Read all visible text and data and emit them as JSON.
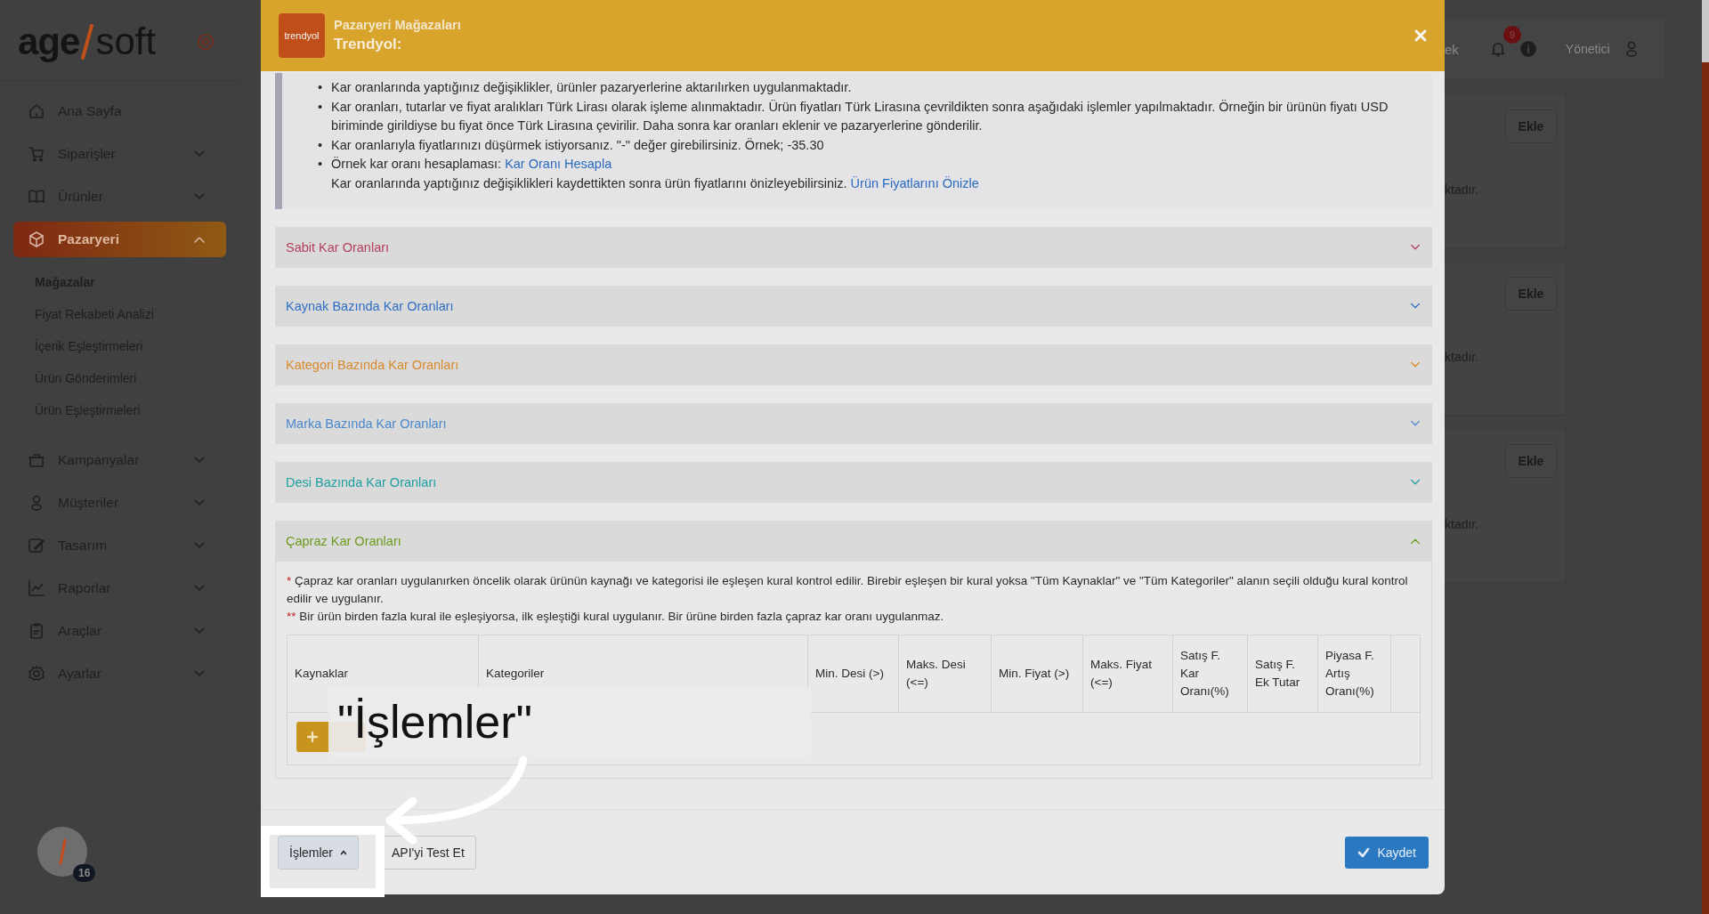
{
  "sidebar": {
    "items": [
      {
        "label": "Ana Sayfa",
        "kind": "link",
        "selected": false
      },
      {
        "label": "Siparişler",
        "kind": "group",
        "selected": false,
        "expanded": false
      },
      {
        "label": "Ürünler",
        "kind": "group",
        "selected": false,
        "expanded": false
      },
      {
        "label": "Pazaryeri",
        "kind": "group",
        "selected": true,
        "expanded": true,
        "children": [
          {
            "label": "Mağazalar",
            "selected": true
          },
          {
            "label": "Fiyat Rekabeti Analizi",
            "selected": false
          },
          {
            "label": "İçerik Eşleştirmeleri",
            "selected": false
          },
          {
            "label": "Ürün Gönderimleri",
            "selected": false
          },
          {
            "label": "Ürün Eşleştirmeleri",
            "selected": false
          }
        ]
      },
      {
        "label": "Kampanyalar",
        "kind": "group",
        "selected": false,
        "expanded": false
      },
      {
        "label": "Müşteriler",
        "kind": "group",
        "selected": false,
        "expanded": false
      },
      {
        "label": "Tasarım",
        "kind": "group",
        "selected": false,
        "expanded": false
      },
      {
        "label": "Raporlar",
        "kind": "group",
        "selected": false,
        "expanded": false
      },
      {
        "label": "Araçlar",
        "kind": "group",
        "selected": false,
        "expanded": false
      },
      {
        "label": "Ayarlar",
        "kind": "group",
        "selected": false,
        "expanded": false
      }
    ],
    "avatar_badge": "16",
    "logo": {
      "left": "age",
      "right": "soft"
    }
  },
  "topbar": {
    "cut_text": "ek",
    "notification_count": "9",
    "user": "Yönetici"
  },
  "cards": [
    {
      "button": "Ekle",
      "text": "ktadır."
    },
    {
      "button": "Ekle",
      "text": "ktadır."
    },
    {
      "button": "Ekle",
      "text": "ktadır."
    }
  ],
  "modal": {
    "logo_text": "trendyol",
    "title": "Pazaryeri Mağazaları",
    "subtitle": "Trendyol:",
    "bullet": "•",
    "info": [
      {
        "lines": [
          {
            "text": "Kar oranlarında yaptığınız değişiklikler, ürünler pazaryerlerine aktarılırken uygulanmaktadır."
          }
        ]
      },
      {
        "lines": [
          {
            "text": "Kar oranları, tutarlar ve fiyat aralıkları Türk Lirası olarak işleme alınmaktadır. Ürün fiyatları Türk Lirasına çevrildikten sonra aşağıdaki işlemler yapılmaktadır. Örneğin bir ürünün fiyatı USD biriminde girildiyse bu fiyat önce Türk Lirasına çevirilir. Daha sonra kar oranları eklenir ve pazaryerlerine gönderilir."
          }
        ]
      },
      {
        "lines": [
          {
            "text": "Kar oranlarıyla fiyatlarınızı düşürmek istiyorsanız. \"-\" değer girebilirsiniz. Örnek; -35.30"
          }
        ]
      },
      {
        "lines": [
          {
            "text": "Örnek kar oranı hesaplaması:",
            "link": "Kar Oranı Hesapla"
          },
          {
            "text": "Kar oranlarında yaptığınız değişiklikleri kaydettikten sonra ürün fiyatlarını önizleyebilirsiniz.",
            "link": "Ürün Fiyatlarını Önizle"
          }
        ]
      }
    ],
    "accordions": [
      {
        "title": "Sabit Kar Oranları",
        "color": "#b5405e",
        "expanded": false
      },
      {
        "title": "Kaynak Bazında Kar Oranları",
        "color": "#2f6fc4",
        "expanded": false
      },
      {
        "title": "Kategori Bazında Kar Oranları",
        "color": "#d88a2c",
        "expanded": false
      },
      {
        "title": "Marka Bazında Kar Oranları",
        "color": "#4a88cc",
        "expanded": false
      },
      {
        "title": "Desi Bazında Kar Oranları",
        "color": "#1e9fa0",
        "expanded": false
      },
      {
        "title": "Çapraz Kar Oranları",
        "color": "#6c9a1c",
        "expanded": true,
        "notes": [
          {
            "mark": "*",
            "text": "Çapraz kar oranları uygulanırken öncelik olarak ürünün kaynağı ve kategorisi ile eşleşen kural kontrol edilir. Birebir eşleşen bir kural yoksa \"Tüm Kaynaklar\" ve \"Tüm Kategoriler\" alanın seçili olduğu kural kontrol edilir ve uygulanır."
          },
          {
            "mark": "**",
            "text": "Bir ürün birden fazla kural ile eşleşiyorsa, ilk eşleştiği kural uygulanır. Bir ürüne birden fazla çapraz kar oranı uygulanmaz."
          }
        ],
        "columns": [
          "Kaynaklar",
          "Kategoriler",
          "Min. Desi (>)",
          "Maks. Desi (<=)",
          "Min. Fiyat (>)",
          "Maks. Fiyat (<=)",
          "Satış F. Kar Oranı(%)",
          "Satış F. Ek Tutar",
          "Piyasa F. Artış Oranı(%)"
        ]
      }
    ],
    "footer": {
      "actions": "İşlemler",
      "test": "API'yi Test Et",
      "save": "Kaydet"
    }
  },
  "annotation": {
    "callout": "\"İşlemler\""
  }
}
